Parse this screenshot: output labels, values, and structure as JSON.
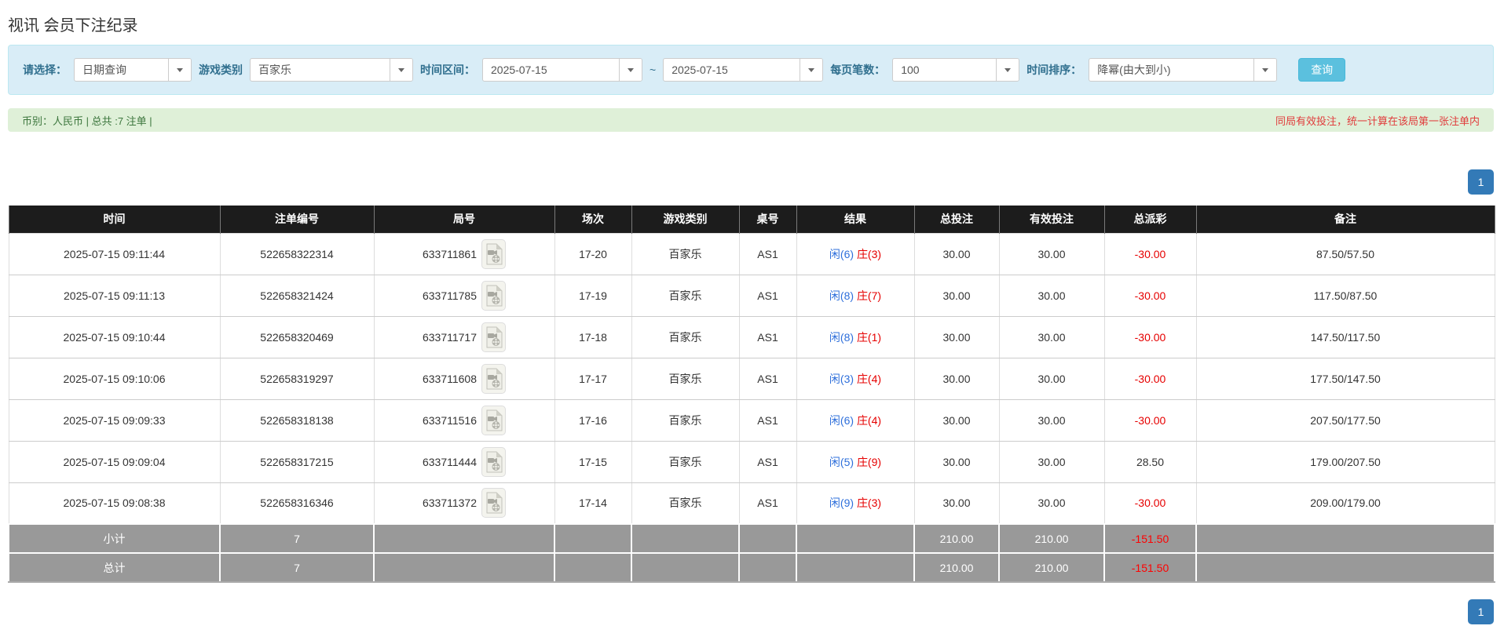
{
  "page": {
    "title": "视讯 会员下注纪录"
  },
  "filters": {
    "select_label": "请选择：",
    "select_value": "日期查询",
    "game_label": "游戏类别",
    "game_value": "百家乐",
    "range_label": "时间区间：",
    "date_from": "2025-07-15",
    "range_sep": "~",
    "date_to": "2025-07-15",
    "page_size_label": "每页笔数：",
    "page_size_value": "100",
    "sort_label": "时间排序：",
    "sort_value": "降幂(由大到小)",
    "search_button": "查询"
  },
  "summary": {
    "left": "币别：人民币 | 总共 :7 注单 |",
    "right_note": "同局有效投注，统一计算在该局第一张注单内"
  },
  "pagination": {
    "page": "1"
  },
  "icons": {
    "dropdown_caret": "caret-down",
    "round_video": "video-replay-file"
  },
  "colors": {
    "accent": "#5bc0de",
    "label_blue": "#31708f",
    "bet_blue": "#2e6fdb",
    "negative_red": "#e60000",
    "header_bg": "#1c1c1c",
    "highlight_yellow": "#ffff99",
    "totals_gray": "#999999",
    "pager_blue": "#337ab7",
    "summary_green_bg": "#dff0d8",
    "note_red": "#e03c3c"
  },
  "table": {
    "headers": [
      "时间",
      "注单编号",
      "局号",
      "场次",
      "游戏类别",
      "桌号",
      "结果",
      "总投注",
      "有效投注",
      "总派彩",
      "备注"
    ],
    "rows": [
      {
        "time": "2025-07-15 09:11:44",
        "bet_id": "522658322314",
        "round_id": "633711861",
        "session": "17-20",
        "game": "百家乐",
        "table_id": "AS1",
        "result_player": "闲(6)",
        "result_banker": "庄(3)",
        "total_bet": "30.00",
        "valid_bet": "30.00",
        "payout": "-30.00",
        "remark": "87.50/57.50",
        "highlight": true
      },
      {
        "time": "2025-07-15 09:11:13",
        "bet_id": "522658321424",
        "round_id": "633711785",
        "session": "17-19",
        "game": "百家乐",
        "table_id": "AS1",
        "result_player": "闲(8)",
        "result_banker": "庄(7)",
        "total_bet": "30.00",
        "valid_bet": "30.00",
        "payout": "-30.00",
        "remark": "117.50/87.50",
        "highlight": false
      },
      {
        "time": "2025-07-15 09:10:44",
        "bet_id": "522658320469",
        "round_id": "633711717",
        "session": "17-18",
        "game": "百家乐",
        "table_id": "AS1",
        "result_player": "闲(8)",
        "result_banker": "庄(1)",
        "total_bet": "30.00",
        "valid_bet": "30.00",
        "payout": "-30.00",
        "remark": "147.50/117.50",
        "highlight": false
      },
      {
        "time": "2025-07-15 09:10:06",
        "bet_id": "522658319297",
        "round_id": "633711608",
        "session": "17-17",
        "game": "百家乐",
        "table_id": "AS1",
        "result_player": "闲(3)",
        "result_banker": "庄(4)",
        "total_bet": "30.00",
        "valid_bet": "30.00",
        "payout": "-30.00",
        "remark": "177.50/147.50",
        "highlight": false
      },
      {
        "time": "2025-07-15 09:09:33",
        "bet_id": "522658318138",
        "round_id": "633711516",
        "session": "17-16",
        "game": "百家乐",
        "table_id": "AS1",
        "result_player": "闲(6)",
        "result_banker": "庄(4)",
        "total_bet": "30.00",
        "valid_bet": "30.00",
        "payout": "-30.00",
        "remark": "207.50/177.50",
        "highlight": false
      },
      {
        "time": "2025-07-15 09:09:04",
        "bet_id": "522658317215",
        "round_id": "633711444",
        "session": "17-15",
        "game": "百家乐",
        "table_id": "AS1",
        "result_player": "闲(5)",
        "result_banker": "庄(9)",
        "total_bet": "30.00",
        "valid_bet": "30.00",
        "payout": "28.50",
        "remark": "179.00/207.50",
        "highlight": false
      },
      {
        "time": "2025-07-15 09:08:38",
        "bet_id": "522658316346",
        "round_id": "633711372",
        "session": "17-14",
        "game": "百家乐",
        "table_id": "AS1",
        "result_player": "闲(9)",
        "result_banker": "庄(3)",
        "total_bet": "30.00",
        "valid_bet": "30.00",
        "payout": "-30.00",
        "remark": "209.00/179.00",
        "highlight": false
      }
    ],
    "subtotal": {
      "label": "小计",
      "count": "7",
      "total_bet": "210.00",
      "valid_bet": "210.00",
      "payout": "-151.50"
    },
    "total": {
      "label": "总计",
      "count": "7",
      "total_bet": "210.00",
      "valid_bet": "210.00",
      "payout": "-151.50"
    }
  }
}
